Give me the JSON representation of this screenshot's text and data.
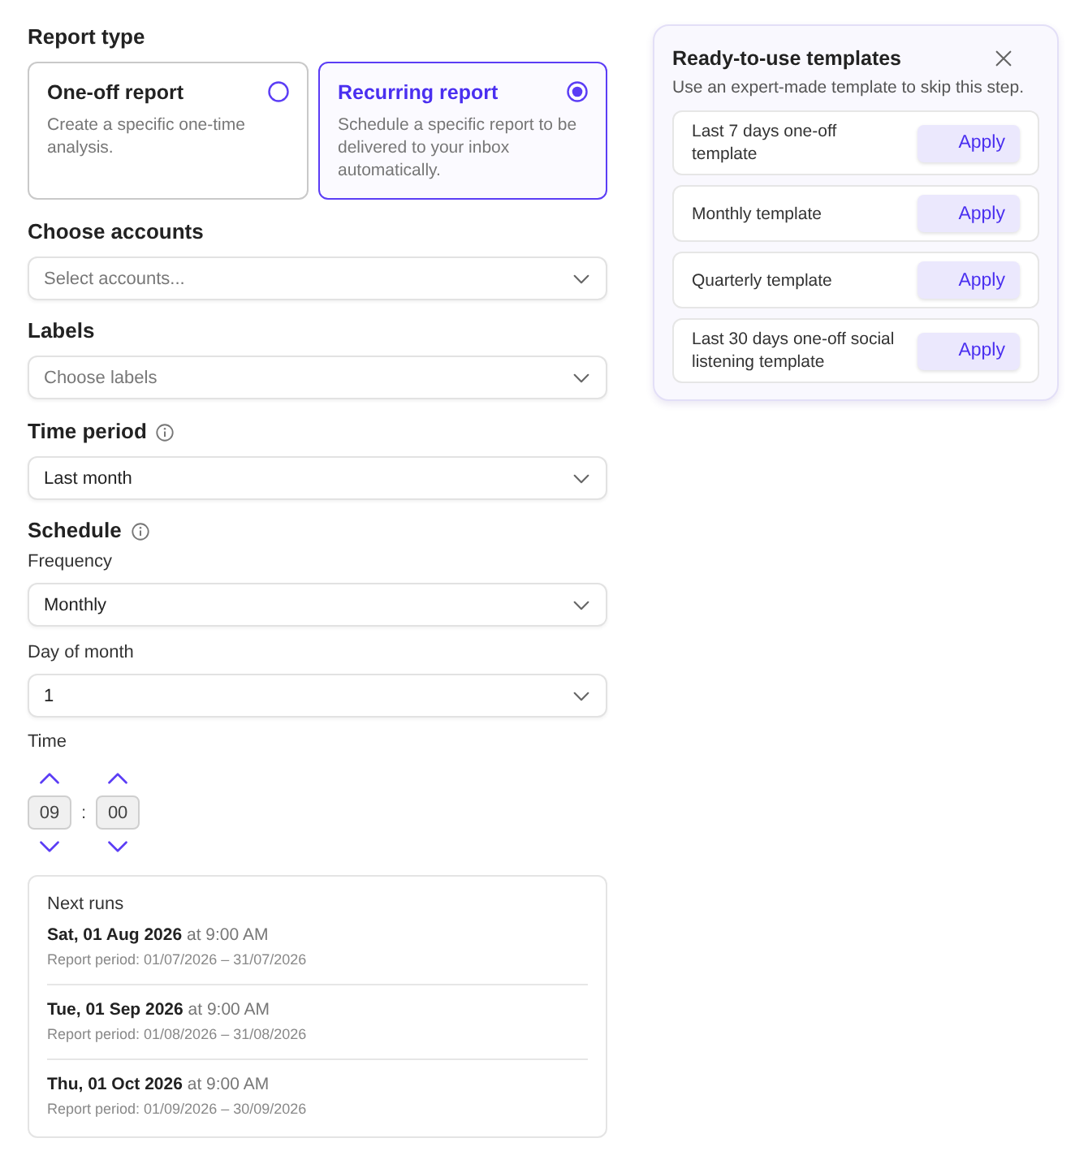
{
  "report_type": {
    "label": "Report type",
    "options": [
      {
        "title": "One-off report",
        "description": "Create a specific one-time analysis.",
        "selected": false
      },
      {
        "title": "Recurring report",
        "description": "Schedule a specific report to be delivered to your inbox automatically.",
        "selected": true
      }
    ]
  },
  "accounts": {
    "label": "Choose accounts",
    "placeholder": "Select accounts..."
  },
  "labels": {
    "label": "Labels",
    "placeholder": "Choose labels"
  },
  "time_period": {
    "label": "Time period",
    "value": "Last month"
  },
  "schedule": {
    "label": "Schedule",
    "frequency": {
      "label": "Frequency",
      "value": "Monthly"
    },
    "day_of_month": {
      "label": "Day of month",
      "value": "1"
    },
    "time": {
      "label": "Time",
      "hour": "09",
      "separator": ":",
      "minute": "00"
    }
  },
  "next_runs": {
    "title": "Next runs",
    "runs": [
      {
        "when": "**Sat, 01 Aug 2026** at 9:00 AM",
        "period": "Report period: 01/07/2026 – 31/07/2026"
      },
      {
        "when": "**Tue, 01 Sep 2026** at 9:00 AM",
        "period": "Report period: 01/08/2026 – 31/08/2026"
      },
      {
        "when": "**Thu, 01 Oct 2026** at 9:00 AM",
        "period": "Report period: 01/09/2026 – 30/09/2026"
      }
    ]
  },
  "templates_panel": {
    "title": "Ready-to-use templates",
    "subtitle": "Use an expert-made template to skip this step.",
    "templates": [
      {
        "name": "Last 7 days one-off template",
        "button": "Apply"
      },
      {
        "name": "Monthly template",
        "button": "Apply"
      },
      {
        "name": "Quarterly template",
        "button": "Apply"
      },
      {
        "name": "Last 30 days one-off social listening template",
        "button": "Apply"
      }
    ]
  }
}
